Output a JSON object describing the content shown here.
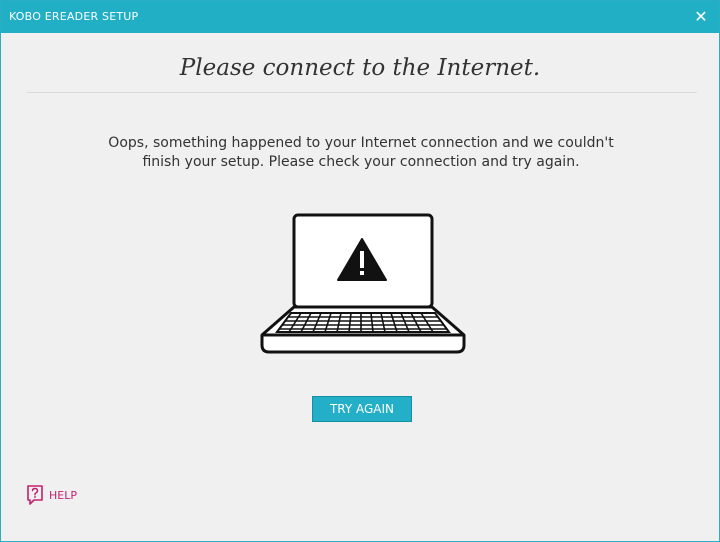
{
  "window": {
    "title": "KOBO EREADER SETUP",
    "close_glyph": "✕"
  },
  "main": {
    "heading": "Please connect to the Internet.",
    "message_line1": "Oops, something happened to your Internet connection and we couldn't",
    "message_line2": "finish your setup. Please check your connection and try again.",
    "illustration": "laptop-warning-icon",
    "try_again_label": "TRY AGAIN"
  },
  "footer": {
    "help_label": "HELP",
    "help_icon": "help-question-icon"
  },
  "colors": {
    "titlebar": "#21afc6",
    "button": "#22afc7",
    "help_accent": "#c4216f",
    "background": "#f0f0f0"
  }
}
